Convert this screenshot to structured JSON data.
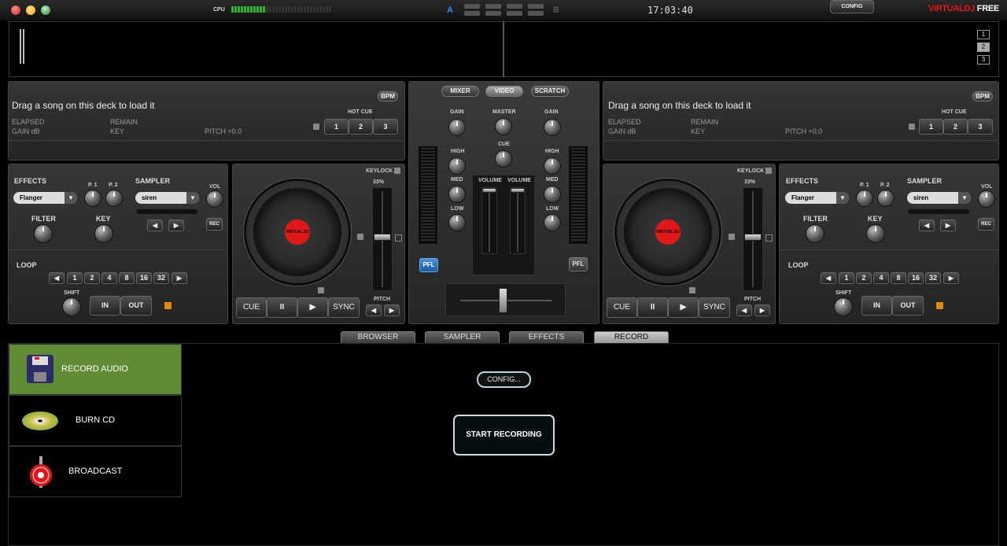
{
  "top": {
    "cpu_label": "CPU",
    "cpu_level": 0.33,
    "a": "A",
    "b": "B",
    "clock": "17:03:40",
    "config": "CONFIG",
    "brand_red": "VIRTUAL",
    "brand_red2": "DJ",
    "brand_white": " FREE"
  },
  "wave": {
    "layers": [
      "1",
      "2",
      "3"
    ]
  },
  "deck_left": {
    "title": "Drag a song on this deck to load it",
    "bpm": "BPM",
    "elapsed": "ELAPSED",
    "remain": "REMAIN",
    "gain": "GAIN dB",
    "key": "KEY",
    "pitch": "PITCH +0.0",
    "hotcue": "HOT CUE",
    "hc": [
      "1",
      "2",
      "3"
    ]
  },
  "deck_right": {
    "title": "Drag a song on this deck to load it",
    "bpm": "BPM",
    "elapsed": "ELAPSED",
    "remain": "REMAIN",
    "gain": "GAIN dB",
    "key": "KEY",
    "pitch": "PITCH +0.0",
    "hotcue": "HOT CUE",
    "hc": [
      "1",
      "2",
      "3"
    ]
  },
  "fx": {
    "effects": "EFFECTS",
    "p1": "P. 1",
    "p2": "P. 2",
    "effect_value": "Flanger",
    "sampler": "SAMPLER",
    "sampler_value": "siren",
    "vol": "VOL",
    "filter": "FILTER",
    "key": "KEY",
    "rec": "REC",
    "loop": "LOOP",
    "loop_sizes": [
      "1",
      "2",
      "4",
      "8",
      "16",
      "32"
    ],
    "shift": "SHIFT",
    "in": "IN",
    "out": "OUT"
  },
  "platter": {
    "keylock": "KEYLOCK",
    "pct": "33%",
    "label": "VIRTUAL DJ",
    "cue": "CUE",
    "pause": "II",
    "play": "▶",
    "sync": "SYNC",
    "pitch": "PITCH"
  },
  "mixer": {
    "tabs": [
      "MIXER",
      "VIDEO",
      "SCRATCH"
    ],
    "gain": "GAIN",
    "master": "MASTER",
    "cue": "CUE",
    "high": "HIGH",
    "med": "MED",
    "low": "LOW",
    "volume": "VOLUME",
    "pfl": "PFL"
  },
  "browser_tabs": [
    "BROWSER",
    "SAMPLER",
    "EFFECTS",
    "RECORD"
  ],
  "record": {
    "items": [
      "RECORD AUDIO",
      "BURN CD",
      "BROADCAST"
    ],
    "config": "CONFIG...",
    "start": "START RECORDING"
  },
  "colors": {
    "accent_green": "#5f8a36",
    "cpu_green": "#2fb52f",
    "platter_red": "#e01818",
    "pfl_blue": "#2a6fb0"
  }
}
